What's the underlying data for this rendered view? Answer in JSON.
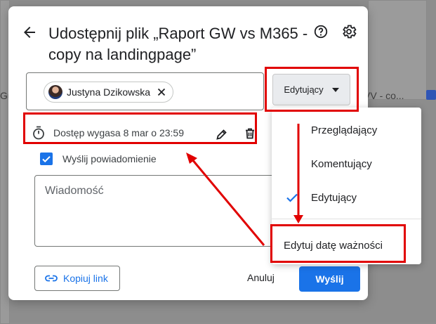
{
  "dialog": {
    "title": "Udostępnij plik „Raport GW vs M365 - copy na landingpage”",
    "back_icon": "arrow-left",
    "help_icon": "help-circle",
    "settings_icon": "gear"
  },
  "recipients": [
    {
      "name": "Justyna Dzikowska"
    }
  ],
  "role_button": {
    "label": "Edytujący"
  },
  "expiry": {
    "text": "Dostęp wygasa 8 mar o 23:59"
  },
  "notify": {
    "label": "Wyślij powiadomienie",
    "checked": true
  },
  "message": {
    "placeholder": "Wiadomość"
  },
  "footer": {
    "copy_link_label": "Kopiuj link",
    "cancel_label": "Anuluj",
    "send_label": "Wyślij"
  },
  "role_menu": {
    "items": [
      "Przeglądający",
      "Komentujący",
      "Edytujący"
    ],
    "selected": "Edytujący",
    "expiry_action": "Edytuj datę ważności"
  },
  "background": {
    "left_fragment": "Gu",
    "right_fragment": "VV - co..."
  },
  "colors": {
    "accent": "#1a73e8",
    "highlight": "#e10000"
  }
}
